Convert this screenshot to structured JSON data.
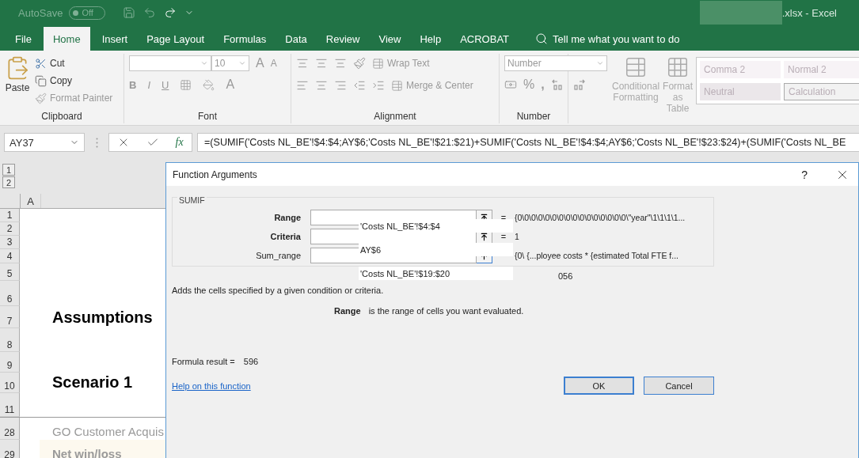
{
  "title_bar": {
    "autosave_label": "AutoSave",
    "autosave": {
      "label": "Off",
      "on": false
    },
    "file_name": ".xlsx  -  Excel"
  },
  "tabs": [
    {
      "label": "File",
      "selected": false
    },
    {
      "label": "Home",
      "selected": true
    },
    {
      "label": "Insert",
      "selected": false
    },
    {
      "label": "Page Layout",
      "selected": false
    },
    {
      "label": "Formulas",
      "selected": false
    },
    {
      "label": "Data",
      "selected": false
    },
    {
      "label": "Review",
      "selected": false
    },
    {
      "label": "View",
      "selected": false
    },
    {
      "label": "Help",
      "selected": false
    },
    {
      "label": "ACROBAT",
      "selected": false
    }
  ],
  "tell_me": "Tell me what you want to do",
  "ribbon": {
    "clipboard": {
      "paste": "Paste",
      "cut": "Cut",
      "copy": "Copy",
      "format_painter": "Format Painter",
      "label": "Clipboard"
    },
    "font": {
      "size": "10",
      "bold": "B",
      "italic": "I",
      "underline": "U",
      "grow": "A",
      "shrink": "A",
      "font_color_glyph": "A",
      "label": "Font"
    },
    "alignment": {
      "wrap": "Wrap Text",
      "merge": "Merge & Center",
      "label": "Alignment"
    },
    "number": {
      "format": "Number",
      "percent": "%",
      "comma": ",",
      "label": "Number"
    },
    "styles": {
      "conditional": "Conditional Formatting",
      "format_table": "Format as Table",
      "gallery": [
        {
          "label": "Comma 2",
          "kind": "plain"
        },
        {
          "label": "Normal 2",
          "kind": "plain"
        },
        {
          "label": "Neutral",
          "kind": "neutral"
        },
        {
          "label": "Calculation",
          "kind": "calculation"
        }
      ]
    }
  },
  "formula_bar": {
    "name_box": "AY37",
    "insert_function": "fx",
    "formula": "=(SUMIF('Costs NL_BE'!$4:$4;AY$6;'Costs NL_BE'!$21:$21)+SUMIF('Costs NL_BE'!$4:$4;AY$6;'Costs NL_BE'!$23:$24)+(SUMIF('Costs NL_BE"
  },
  "sheet": {
    "outline_levels": [
      "1",
      "2"
    ],
    "column": "A",
    "rows": [
      {
        "number": "1"
      },
      {
        "number": "2"
      },
      {
        "number": "3"
      },
      {
        "number": "4"
      },
      {
        "number": "5"
      },
      {
        "number": "6"
      },
      {
        "number": "7",
        "text": "Assumptions",
        "kind": "title"
      },
      {
        "number": "8"
      },
      {
        "number": "9"
      },
      {
        "number": "10",
        "text": "Scenario 1",
        "kind": "title"
      },
      {
        "number": "11"
      },
      {
        "number": "28",
        "text": "GO Customer Acquis",
        "kind": "muted"
      },
      {
        "number": "29",
        "text": "Net win/loss",
        "kind": "highlight"
      }
    ]
  },
  "dialog": {
    "title": "Function Arguments",
    "help": "?",
    "function": "SUMIF",
    "arguments": [
      {
        "label": "Range",
        "bold": true,
        "value": "'Costs NL_BE'!$4:$4",
        "equals": "=",
        "result": "{0\\0\\0\\0\\0\\0\\0\\0\\0\\0\\0\\0\\0\\0\\0\\0\\\"year\"\\1\\1\\1\\1..."
      },
      {
        "label": "Criteria",
        "bold": true,
        "value": "AY$6",
        "equals": "=",
        "result": "1"
      },
      {
        "label": "Sum_range",
        "bold": false,
        "value": "'Costs NL_BE'!$19:$20",
        "result": "{0\\   {...ployee costs  *  {estimated Total FTE f..."
      }
    ],
    "partial_result": "056",
    "description": "Adds the cells specified by a given condition or criteria.",
    "arg_help": {
      "name": "Range",
      "text": "is the range of cells you want evaluated."
    },
    "formula_result_label": "Formula result =",
    "formula_result": "596",
    "help_link": "Help on this function",
    "buttons": [
      {
        "label": "OK",
        "default": true
      },
      {
        "label": "Cancel",
        "default": false
      }
    ]
  }
}
